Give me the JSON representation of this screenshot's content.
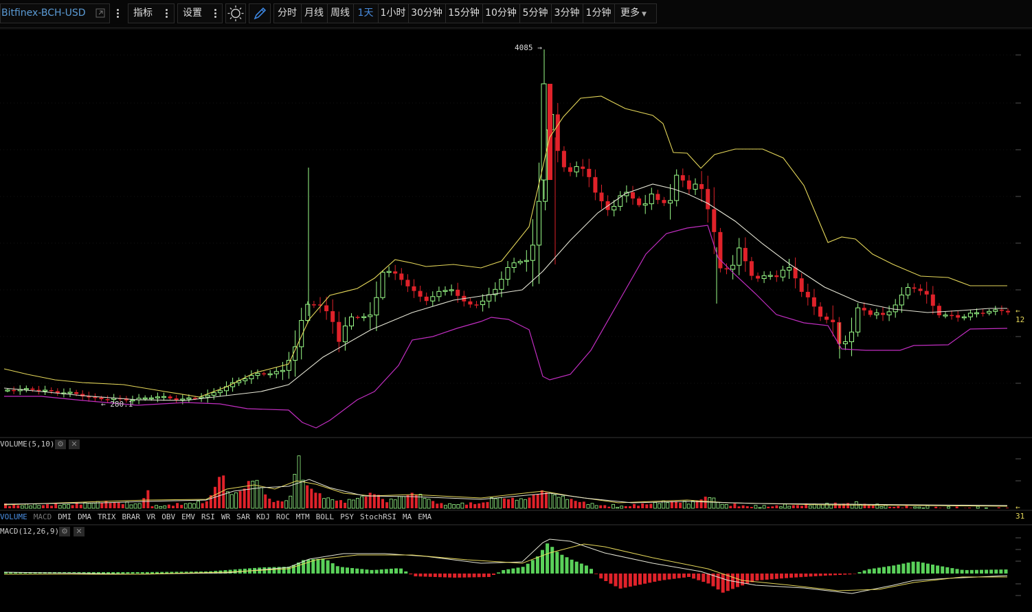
{
  "toolbar": {
    "symbol": "Bitfinex-BCH-USD",
    "indicators_label": "指标",
    "settings_label": "设置",
    "timeframes": [
      "分时",
      "月线",
      "周线",
      "1天",
      "1小时",
      "30分钟",
      "15分钟",
      "10分钟",
      "5分钟",
      "3分钟",
      "1分钟"
    ],
    "active_timeframe": "1天",
    "more_label": "更多"
  },
  "main_chart": {
    "high_label": "4085",
    "low_label": "280.1",
    "last_price_label": "12",
    "colors": {
      "up": "#9cff8a",
      "down": "#e0222a",
      "upper_band": "#e6d85a",
      "mid_band": "#e8e8d8",
      "lower_band": "#c22ec2"
    }
  },
  "volume_panel": {
    "title": "VOLUME(5,10)",
    "last_value_label": "31"
  },
  "indicator_tabs": [
    "VOLUME",
    "MACD",
    "DMI",
    "DMA",
    "TRIX",
    "BRAR",
    "VR",
    "OBV",
    "EMV",
    "RSI",
    "WR",
    "SAR",
    "KDJ",
    "ROC",
    "MTM",
    "BOLL",
    "PSY",
    "StochRSI",
    "MA",
    "EMA"
  ],
  "active_indicator_tab": "VOLUME",
  "macd_panel": {
    "title": "MACD(12,26,9)"
  },
  "icons": {
    "share": "external-link-icon",
    "theme": "sun-icon",
    "draw": "pencil-icon",
    "gear": "gear-icon",
    "close": "close-icon",
    "more": "chevron-down-icon"
  }
}
